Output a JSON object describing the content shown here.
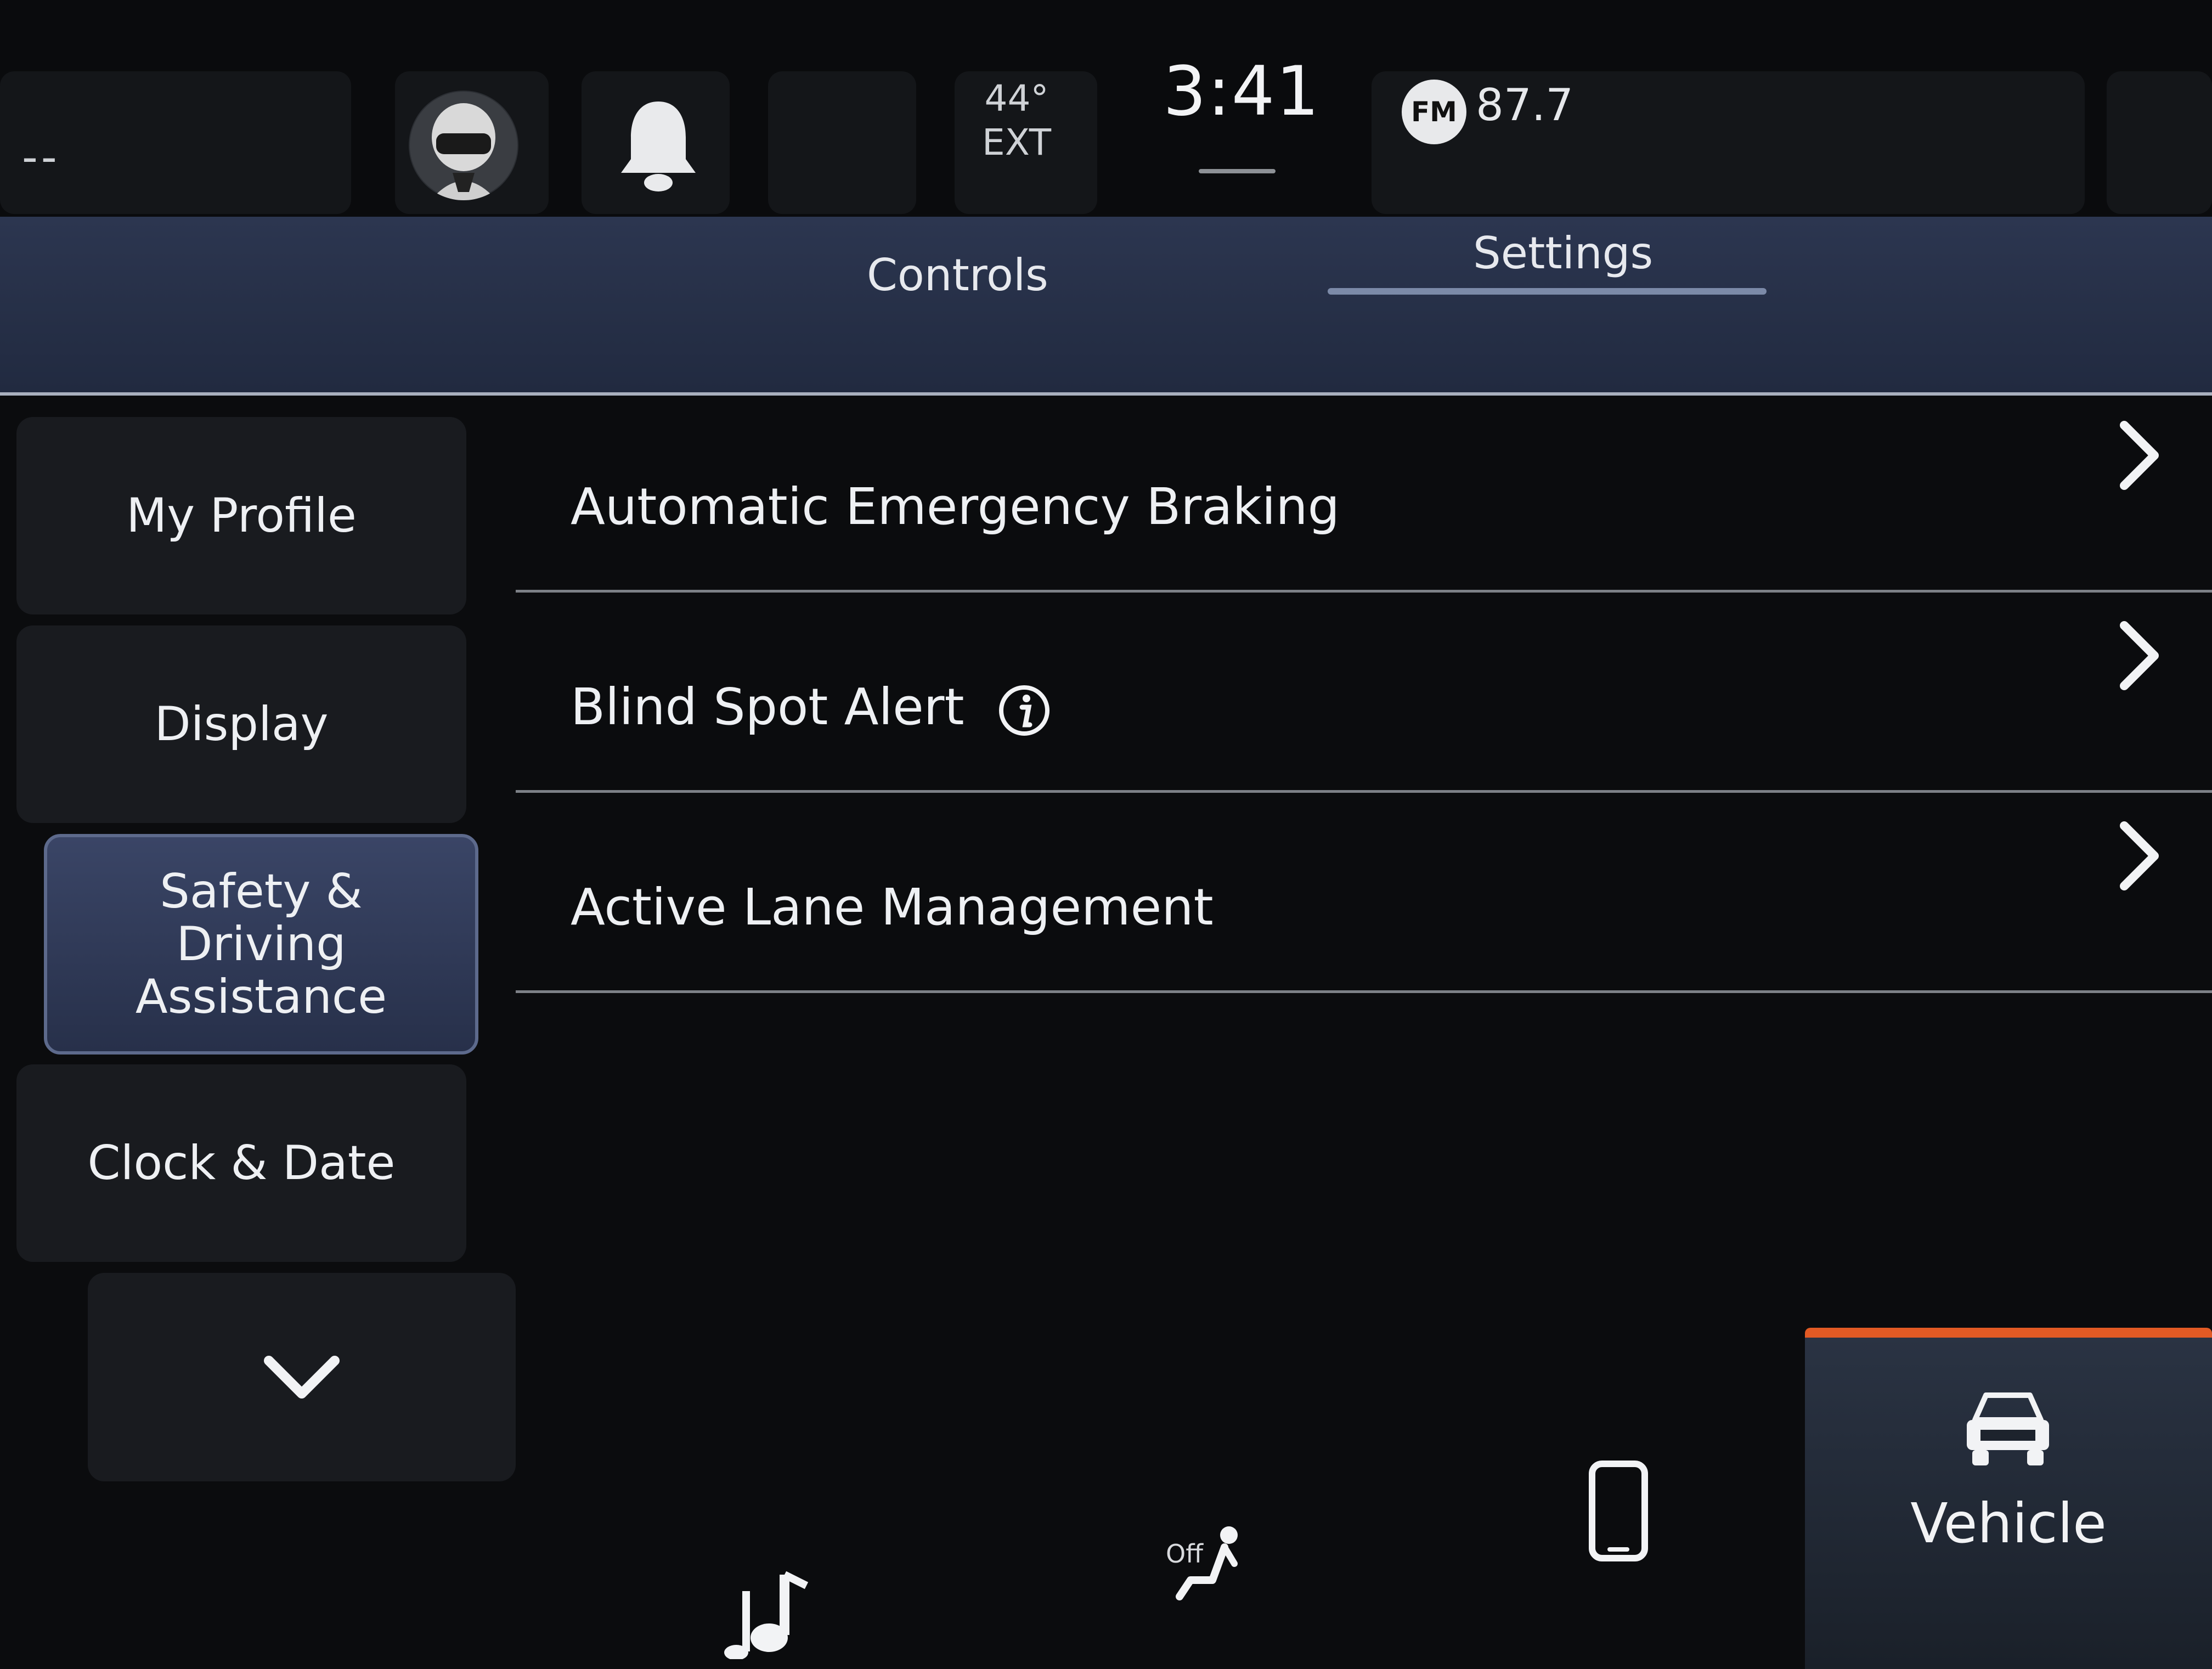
{
  "status_bar": {
    "left_placeholder": "--",
    "outside_temp": "44°",
    "outside_temp_label": "EXT",
    "time": "3:41",
    "radio_band": "FM",
    "radio_frequency": "87.7"
  },
  "tabs": [
    {
      "label": "Controls",
      "active": false
    },
    {
      "label": "Settings",
      "active": true
    }
  ],
  "sidebar": {
    "items": [
      {
        "label": "My Profile",
        "active": false
      },
      {
        "label": "Display",
        "active": false
      },
      {
        "label": "Safety & Driving Assistance",
        "active": true
      },
      {
        "label": "Clock & Date",
        "active": false
      }
    ],
    "more_icon": "chevron-down-icon"
  },
  "settings_list": [
    {
      "label": "Automatic Emergency Braking",
      "has_info": false,
      "icon": "chevron-right-icon"
    },
    {
      "label": "Blind Spot Alert",
      "has_info": true,
      "icon": "chevron-right-icon"
    },
    {
      "label": "Active Lane Management",
      "has_info": false,
      "icon": "chevron-right-icon"
    }
  ],
  "dock": {
    "seat_status": "Off",
    "vehicle_label": "Vehicle",
    "icons": [
      "music-note-icon",
      "seat-icon",
      "phone-icon",
      "vehicle-icon"
    ]
  },
  "colors": {
    "accent_orange": "#e25a24",
    "tab_band": "#2c3650",
    "active_item": "#3a4566"
  }
}
